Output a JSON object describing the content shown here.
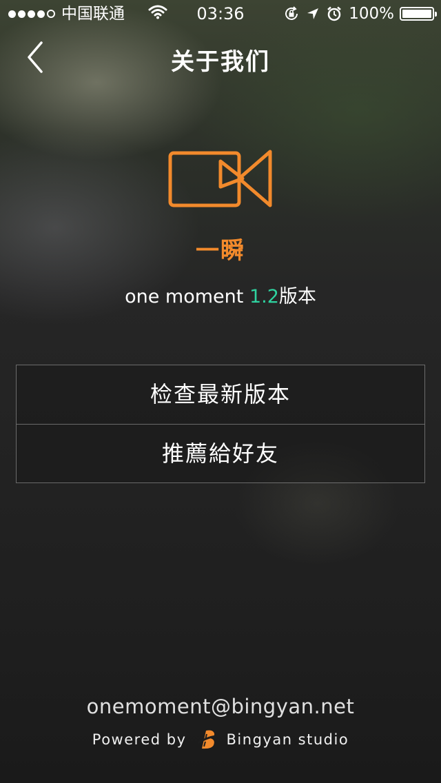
{
  "status_bar": {
    "signal_dots_full": 4,
    "signal_dots_total": 5,
    "carrier": "中国联通",
    "time": "03:36",
    "battery_percent_label": "100%",
    "battery_level": 1.0,
    "icons": [
      "signal-dots-icon",
      "wifi-icon",
      "rotation-lock-icon",
      "location-arrow-icon",
      "alarm-icon",
      "battery-icon"
    ]
  },
  "nav": {
    "back_icon": "chevron-left-icon",
    "title": "关于我们"
  },
  "app": {
    "logo_icon": "video-camera-icon",
    "name": "一瞬",
    "version_prefix": "one moment ",
    "version_number": "1.2",
    "version_suffix": "版本"
  },
  "menu": {
    "items": [
      {
        "label": "检查最新版本"
      },
      {
        "label": "推薦給好友"
      }
    ]
  },
  "footer": {
    "email": "onemoment@bingyan.net",
    "powered_by": "Powered by",
    "studio_icon": "bingyan-logo-icon",
    "studio": "Bingyan studio"
  },
  "colors": {
    "accent_orange": "#f28a2c",
    "version_green": "#2fd3a0",
    "text": "#ffffff"
  }
}
